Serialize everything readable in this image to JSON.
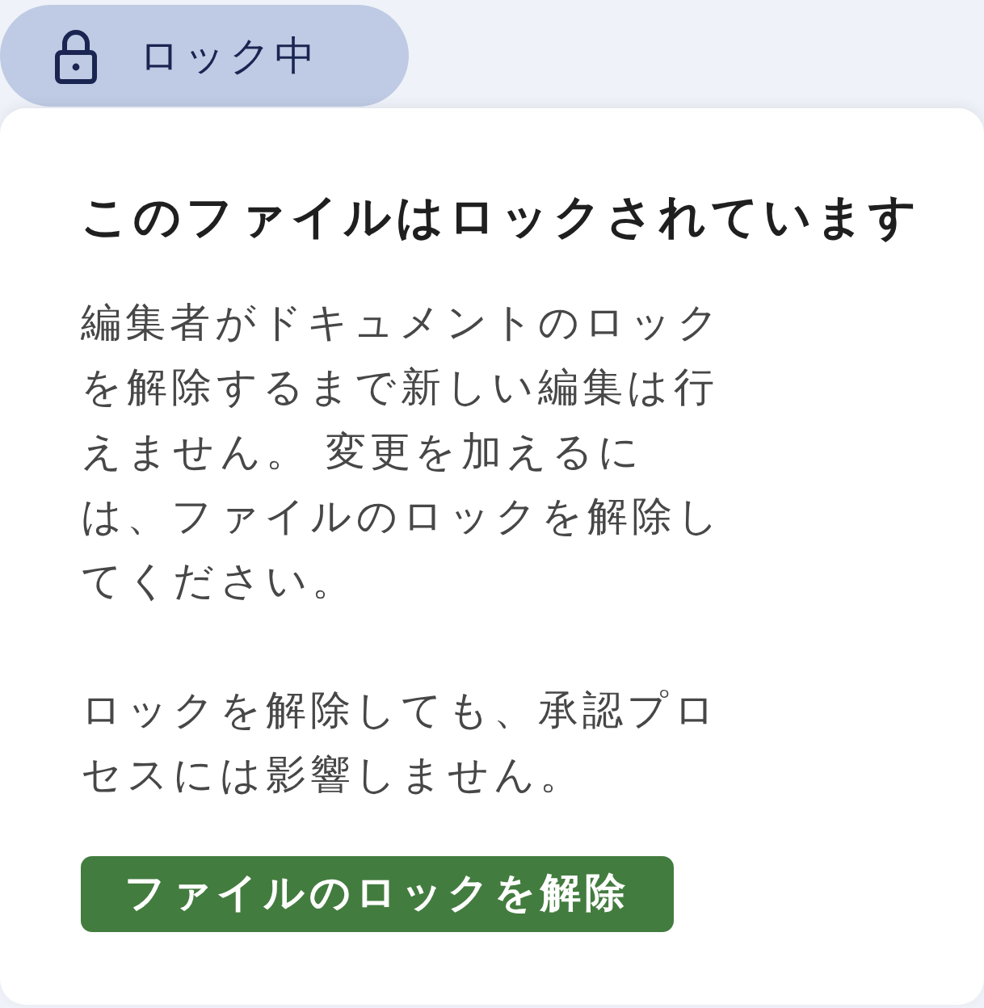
{
  "status_badge": {
    "label": "ロック中"
  },
  "dialog": {
    "title": "このファイルはロックされています",
    "paragraphs": [
      {
        "lines": [
          "編集者がドキュメントのロック",
          "を解除するまで新しい編集は行",
          "えません。 変更を加えるに",
          "は、ファイルのロックを解除し",
          "てください。"
        ]
      },
      {
        "lines": [
          "ロックを解除しても、承認プロ",
          "セスには影響しません。"
        ]
      }
    ],
    "button": {
      "label": "ファイルのロックを解除"
    }
  }
}
